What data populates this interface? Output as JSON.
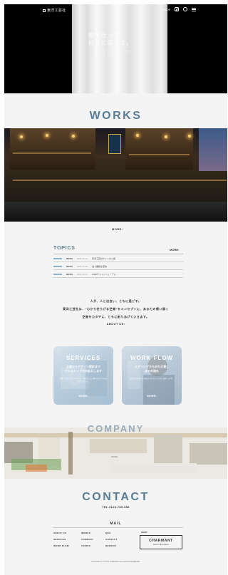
{
  "header": {
    "logo_text": "東洋工芸社",
    "nav_label": "SHOP",
    "icons": [
      "instagram-icon",
      "circle-icon",
      "menu-icon"
    ]
  },
  "hero": {
    "headline_line1": "働を仕って、",
    "headline_line2": "好きに暮らす。",
    "subline": "ポキポキ ウッドゾーン デザイン"
  },
  "works": {
    "title": "WORKS",
    "more": "MORE›"
  },
  "topics": {
    "title": "TOPICS",
    "more": "MORE›",
    "items": [
      {
        "category": "NEWS",
        "date": "2021.01.12",
        "text": "東洋工芸社サイトを公開"
      },
      {
        "category": "NEWS",
        "date": "2021.01.20",
        "text": "電子書籍を配信"
      },
      {
        "category": "NEWS",
        "date": "2021.02.03",
        "text": "WEBサイトリニューアル"
      }
    ]
  },
  "about": {
    "line1": "人が、人と出会い、ともに過ごす。",
    "line2": "東洋工芸社は、\"心から安らげる空間\"をコンセプトに、あなたの想い描く",
    "line3": "空間をカタチに、ともに創りあげていきます。",
    "link": "ABOUT US›"
  },
  "cards": {
    "services": {
      "title": "SERVICES",
      "sub1": "企画からデザイン設計まで",
      "sub2": "ワンストップでお応えします",
      "desc": "店舗・住宅・オフィスなど、空間づくりに関わるすべてをお任せください。",
      "more": "MORE›"
    },
    "workflow": {
      "title": "WORK FLOW",
      "sub1": "ヒアリングからお引き渡し",
      "sub2": "までの流れ",
      "desc": "お問い合わせから完成までのステップをご紹介します。",
      "more": "MORE›"
    }
  },
  "company": {
    "title": "COMPANY",
    "more": "MORE›"
  },
  "contact": {
    "title": "CONTACT",
    "tel": "TEL.0120-789-358",
    "mail": "MAIL"
  },
  "footer": {
    "col1": [
      "ABOUT US",
      "SERVICES",
      "WORK FLOW"
    ],
    "col2": [
      "WORKS",
      "COMPANY",
      "TOPICS"
    ],
    "col3": [
      "Q&A",
      "CONTACT",
      "RECRUIT"
    ],
    "shop_label": "SHOP",
    "shop_name": "CHARMANT",
    "shop_sub": "Select Boutique",
    "copyright": "COPYRIGHT © TOYO KOGEISHA ALL RIGHTS RESERVED."
  },
  "colors": {
    "accent": "#5a7d96",
    "background": "#f4f4f4",
    "hero_bg": "#000000"
  }
}
